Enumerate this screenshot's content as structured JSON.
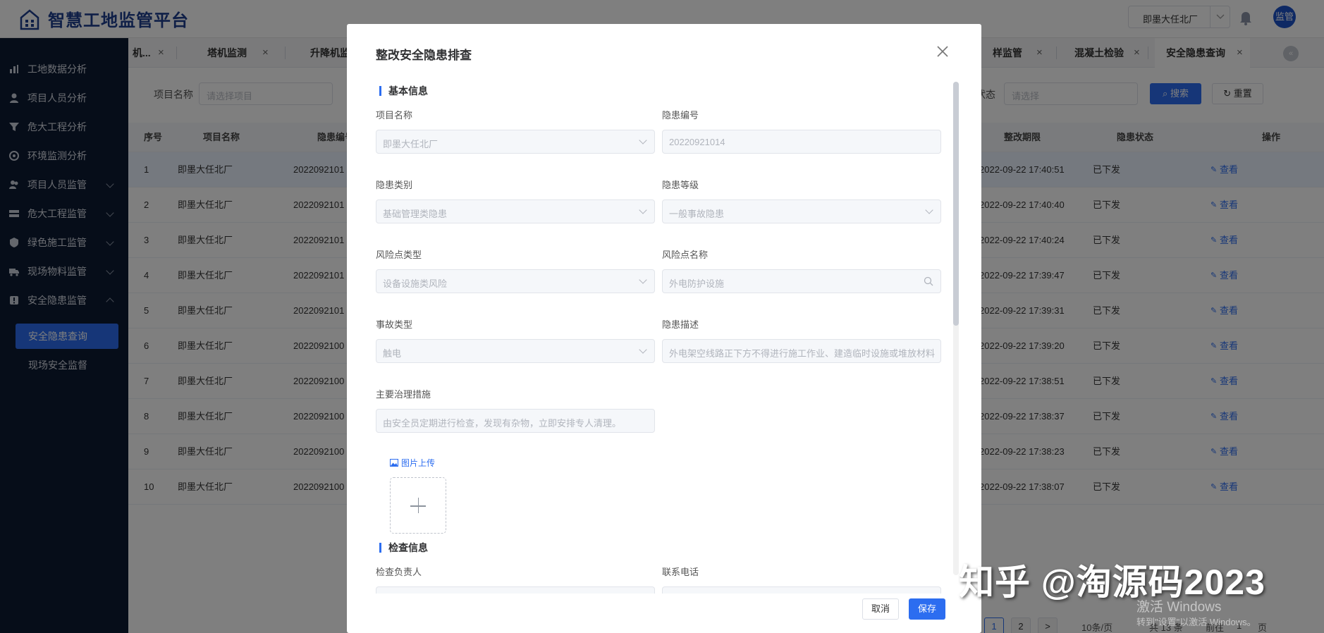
{
  "app": {
    "title": "智慧工地监管平台",
    "project_select": "即墨大任北厂",
    "avatar": "监管"
  },
  "sidebar": {
    "items": [
      {
        "label": "工地数据分析",
        "icon": "chart-icon"
      },
      {
        "label": "项目人员分析",
        "icon": "person-icon"
      },
      {
        "label": "危大工程分析",
        "icon": "filter-icon"
      },
      {
        "label": "环境监测分析",
        "icon": "leaf-icon"
      },
      {
        "label": "项目人员监管",
        "icon": "people-icon"
      },
      {
        "label": "危大工程监管",
        "icon": "stack-icon"
      },
      {
        "label": "绿色施工监管",
        "icon": "shield-icon"
      },
      {
        "label": "现场物料监管",
        "icon": "truck-icon"
      },
      {
        "label": "安全隐患监管",
        "icon": "alert-icon"
      }
    ],
    "sub_items": [
      {
        "label": "安全隐患查询"
      },
      {
        "label": "现场安全监督"
      }
    ]
  },
  "tabs": [
    "机...",
    "塔机监测",
    "升降机监",
    "样监管",
    "混凝土检验",
    "安全隐患查询"
  ],
  "tab_more": "«",
  "filters": {
    "project_label": "项目名称",
    "project_placeholder": "请选择项目",
    "status_label": "状态",
    "status_placeholder": "请选择",
    "search_label": "搜索",
    "reset_label": "重置"
  },
  "table": {
    "headers": {
      "index": "序号",
      "project": "项目名称",
      "code": "隐患编号",
      "deadline": "整改期限",
      "status": "隐患状态",
      "action": "操作"
    },
    "rows": [
      {
        "index": "1",
        "project": "即墨大任北厂",
        "code": "2022092101",
        "deadline": "2022-09-22 17:40:51",
        "status": "已下发",
        "action": "查看"
      },
      {
        "index": "2",
        "project": "即墨大任北厂",
        "code": "2022092101",
        "deadline": "2022-09-22 17:40:40",
        "status": "已下发",
        "action": "查看"
      },
      {
        "index": "3",
        "project": "即墨大任北厂",
        "code": "2022092101",
        "deadline": "2022-09-22 17:40:24",
        "status": "已下发",
        "action": "查看"
      },
      {
        "index": "4",
        "project": "即墨大任北厂",
        "code": "2022092101",
        "deadline": "2022-09-22 17:39:47",
        "status": "已下发",
        "action": "查看"
      },
      {
        "index": "5",
        "project": "即墨大任北厂",
        "code": "2022092101",
        "deadline": "2022-09-22 17:39:31",
        "status": "已下发",
        "action": "查看"
      },
      {
        "index": "6",
        "project": "即墨大任北厂",
        "code": "2022092100",
        "deadline": "2022-09-22 17:39:20",
        "status": "已下发",
        "action": "查看"
      },
      {
        "index": "7",
        "project": "即墨大任北厂",
        "code": "2022092100",
        "deadline": "2022-09-22 17:38:51",
        "status": "已下发",
        "action": "查看"
      },
      {
        "index": "8",
        "project": "即墨大任北厂",
        "code": "2022092100",
        "deadline": "2022-09-22 17:38:37",
        "status": "已下发",
        "action": "查看"
      },
      {
        "index": "9",
        "project": "即墨大任北厂",
        "code": "2022092100",
        "deadline": "2022-09-22 17:38:23",
        "status": "已下发",
        "action": "查看"
      },
      {
        "index": "10",
        "project": "即墨大任北厂",
        "code": "2022092100",
        "deadline": "2022-09-22 17:38:07",
        "status": "已下发",
        "action": "查看"
      }
    ]
  },
  "pagination": {
    "pages": [
      "1",
      "2"
    ],
    "next": ">",
    "page_size": "10条/页",
    "total": "共 13 条",
    "goto": "前往",
    "goto_value": "1",
    "page_unit": "页"
  },
  "dialog": {
    "title": "整改安全隐患排查",
    "section_basic": "基本信息",
    "section_check": "检查信息",
    "fields": {
      "project_name": {
        "label": "项目名称",
        "value": "即墨大任北厂"
      },
      "hazard_code": {
        "label": "隐患编号",
        "value": "20220921014"
      },
      "hazard_category": {
        "label": "隐患类别",
        "value": "基础管理类隐患"
      },
      "hazard_level": {
        "label": "隐患等级",
        "value": "一般事故隐患"
      },
      "risk_type": {
        "label": "风险点类型",
        "value": "设备设施类风险"
      },
      "risk_name": {
        "label": "风险点名称",
        "value": "外电防护设施"
      },
      "accident_type": {
        "label": "事故类型",
        "value": "触电"
      },
      "hazard_desc": {
        "label": "隐患描述",
        "value": "外电架空线路正下方不得进行施工作业、建造临时设施或堆放材料"
      },
      "measures": {
        "label": "主要治理措施",
        "value": "由安全员定期进行检查，发现有杂物，立即安排专人清理。"
      },
      "inspector": {
        "label": "检查负责人"
      },
      "phone": {
        "label": "联系电话"
      }
    },
    "upload_label": "图片上传",
    "cancel_label": "取消",
    "save_label": "保存"
  },
  "watermark": {
    "text": "知乎 @淘源码2023",
    "win1": "激活 Windows",
    "win2": "转到\"设置\"以激活 Windows。"
  },
  "colors": {
    "accent": "#2c6df0",
    "sidebar_bg": "#0d1b32",
    "brand": "#1f3f8f"
  }
}
